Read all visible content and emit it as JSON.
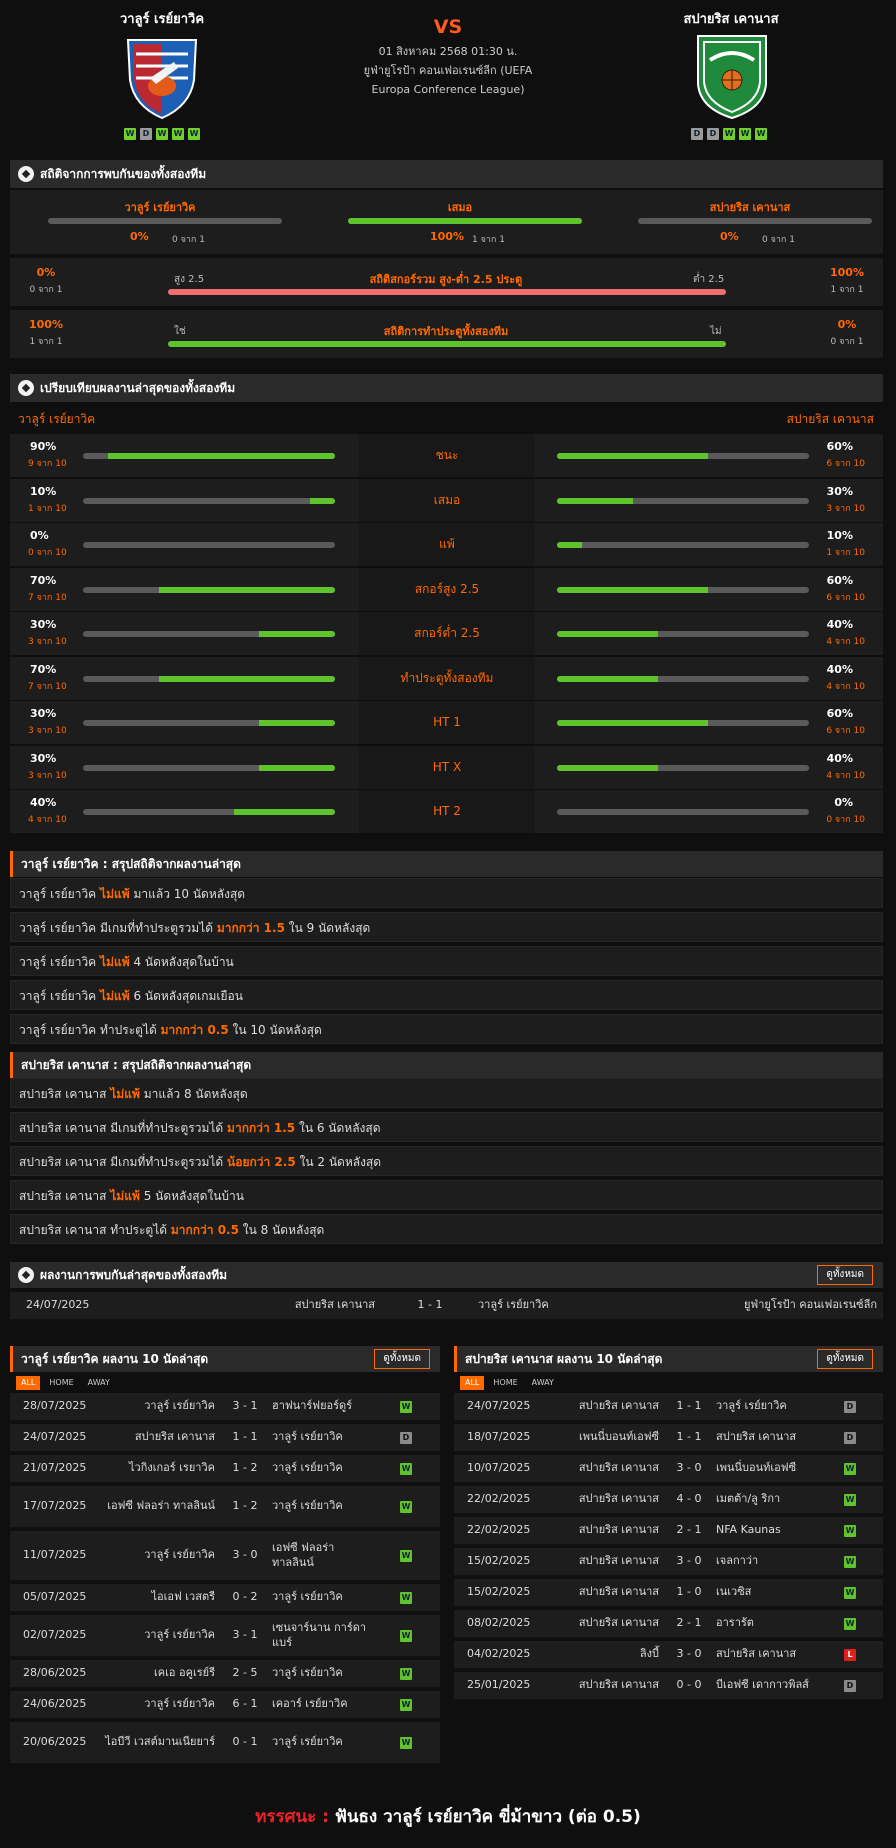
{
  "home": {
    "name": "วาลูร์ เรย์ยาวิค",
    "form": [
      "W",
      "D",
      "W",
      "W",
      "W"
    ]
  },
  "away": {
    "name": "สปายริส เคานาส",
    "form": [
      "D",
      "D",
      "W",
      "W",
      "W"
    ]
  },
  "vs": "VS",
  "match": {
    "date": "01 สิงหาคม 2568 01:30 น.",
    "league": "ยูฟ่ายูโรป้า คอนเฟอเรนซ์ลีก (UEFA Europa Conference League)"
  },
  "h2h_stats": {
    "title": "สถิติจากการพบกันของทั้งสองทีม",
    "results": [
      {
        "label": "วาลูร์ เรย์ยาวิค",
        "pct": "0%",
        "sub": "0 จาก 1",
        "fill": 0
      },
      {
        "label": "เสมอ",
        "pct": "100%",
        "sub": "1 จาก 1",
        "fill": 100
      },
      {
        "label": "สปายริส เคานาส",
        "pct": "0%",
        "sub": "0 จาก 1",
        "fill": 0
      }
    ],
    "ou": {
      "title": "สถิติสกอร์รวม สูง-ต่ำ 2.5 ประตู",
      "left_label": "สูง 2.5",
      "right_label": "ต่ำ 2.5",
      "left_pct": "0%",
      "left_sub": "0 จาก 1",
      "right_pct": "100%",
      "right_sub": "1 จาก 1",
      "fill": 0
    },
    "btts": {
      "title": "สถิติการทำประตูทั้งสองทีม",
      "left_label": "ใช่",
      "right_label": "ไม่",
      "left_pct": "100%",
      "left_sub": "1 จาก 1",
      "right_pct": "0%",
      "right_sub": "0 จาก 1",
      "fill": 100
    }
  },
  "compare": {
    "title": "เปรียบเทียบผลงานล่าสุดของทั้งสองทีม",
    "home_label": "วาลูร์ เรย์ยาวิค",
    "away_label": "สปายริส เคานาส",
    "rows": [
      {
        "label": "ชนะ",
        "hp": "90%",
        "hs": "9 จาก 10",
        "hv": 90,
        "ap": "60%",
        "as": "6 จาก 10",
        "av": 60
      },
      {
        "label": "เสมอ",
        "hp": "10%",
        "hs": "1 จาก 10",
        "hv": 10,
        "ap": "30%",
        "as": "3 จาก 10",
        "av": 30
      },
      {
        "label": "แพ้",
        "hp": "0%",
        "hs": "0 จาก 10",
        "hv": 0,
        "ap": "10%",
        "as": "1 จาก 10",
        "av": 10
      },
      {
        "label": "สกอร์สูง 2.5",
        "hp": "70%",
        "hs": "7 จาก 10",
        "hv": 70,
        "ap": "60%",
        "as": "6 จาก 10",
        "av": 60
      },
      {
        "label": "สกอร์ต่ำ 2.5",
        "hp": "30%",
        "hs": "3 จาก 10",
        "hv": 30,
        "ap": "40%",
        "as": "4 จาก 10",
        "av": 40
      },
      {
        "label": "ทำประตูทั้งสองทีม",
        "hp": "70%",
        "hs": "7 จาก 10",
        "hv": 70,
        "ap": "40%",
        "as": "4 จาก 10",
        "av": 40
      },
      {
        "label": "HT 1",
        "hp": "30%",
        "hs": "3 จาก 10",
        "hv": 30,
        "ap": "60%",
        "as": "6 จาก 10",
        "av": 60
      },
      {
        "label": "HT X",
        "hp": "30%",
        "hs": "3 จาก 10",
        "hv": 30,
        "ap": "40%",
        "as": "4 จาก 10",
        "av": 40
      },
      {
        "label": "HT 2",
        "hp": "40%",
        "hs": "4 จาก 10",
        "hv": 40,
        "ap": "0%",
        "as": "0 จาก 10",
        "av": 0
      }
    ]
  },
  "home_summary": {
    "title": "วาลูร์ เรย์ยาวิค : สรุปสถิติจากผลงานล่าสุด",
    "rows": [
      [
        "วาลูร์ เรย์ยาวิค",
        "ไม่แพ้",
        "มาแล้ว 10 นัดหลังสุด"
      ],
      [
        "วาลูร์ เรย์ยาวิค  มีเกมที่ทำประตูรวมได้",
        "มากกว่า  1.5",
        "ใน 9 นัดหลังสุด"
      ],
      [
        "วาลูร์ เรย์ยาวิค",
        "ไม่แพ้",
        "4  นัดหลังสุดในบ้าน"
      ],
      [
        "วาลูร์ เรย์ยาวิค",
        "ไม่แพ้",
        "6  นัดหลังสุดเกมเยือน"
      ],
      [
        "วาลูร์ เรย์ยาวิค  ทำประตูได้",
        "มากกว่า  0.5",
        "ใน 10 นัดหลังสุด"
      ]
    ]
  },
  "away_summary": {
    "title": "สปายริส เคานาส : สรุปสถิติจากผลงานล่าสุด",
    "rows": [
      [
        "สปายริส เคานาส",
        "ไม่แพ้",
        "มาแล้ว 8 นัดหลังสุด"
      ],
      [
        "สปายริส เคานาส  มีเกมที่ทำประตูรวมได้",
        "มากกว่า  1.5",
        "ใน 6 นัดหลังสุด"
      ],
      [
        "สปายริส เคานาส  มีเกมที่ทำประตูรวมได้",
        "น้อยกว่า  2.5",
        "ใน 2 นัดหลังสุด"
      ],
      [
        "สปายริส เคานาส",
        "ไม่แพ้",
        "5  นัดหลังสุดในบ้าน"
      ],
      [
        "สปายริส เคานาส  ทำประตูได้",
        "มากกว่า  0.5",
        "ใน 8 นัดหลังสุด"
      ]
    ]
  },
  "h2h_results": {
    "title": "ผลงานการพบกันล่าสุดของทั้งสองทีม",
    "all_label": "ดูทั้งหมด",
    "rows": [
      {
        "date": "24/07/2025",
        "home": "สปายริส เคานาส",
        "score": "1 - 1",
        "away": "วาลูร์ เรย์ยาวิค",
        "league": "ยูฟ่ายูโรป้า คอนเฟอเรนซ์ลีก"
      }
    ]
  },
  "tabs": [
    "ALL",
    "HOME",
    "AWAY"
  ],
  "home_last": {
    "title": "วาลูร์ เรย์ยาวิค ผลงาน 10 นัดล่าสุด",
    "all_label": "ดูทั้งหมด",
    "rows": [
      {
        "date": "28/07/2025",
        "home": "วาลูร์ เรย์ยาวิค",
        "score": "3 - 1",
        "away": "ฮาฟนาร์ฟยอร์ดูร์",
        "r": "W"
      },
      {
        "date": "24/07/2025",
        "home": "สปายริส เคานาส",
        "score": "1 - 1",
        "away": "วาลูร์ เรย์ยาวิค",
        "r": "D"
      },
      {
        "date": "21/07/2025",
        "home": "ไวกิงเกอร์ เรยาวิค",
        "score": "1 - 2",
        "away": "วาลูร์ เรย์ยาวิค",
        "r": "W"
      },
      {
        "date": "17/07/2025",
        "home": "เอฟซี ฟลอร่า ทาลลินน์",
        "score": "1 - 2",
        "away": "วาลูร์ เรย์ยาวิค",
        "r": "W"
      },
      {
        "date": "11/07/2025",
        "home": "วาลูร์ เรย์ยาวิค",
        "score": "3 - 0",
        "away": "เอฟซี ฟลอร่า ทาลลินน์",
        "r": "W"
      },
      {
        "date": "05/07/2025",
        "home": "ไอเอฟ เวสตรี",
        "score": "0 - 2",
        "away": "วาลูร์ เรย์ยาวิค",
        "r": "W"
      },
      {
        "date": "02/07/2025",
        "home": "วาลูร์ เรย์ยาวิค",
        "score": "3 - 1",
        "away": "เซนจาร์นาน การ์ดาแบร์",
        "r": "W"
      },
      {
        "date": "28/06/2025",
        "home": "เคเอ อคูเรย์รี",
        "score": "2 - 5",
        "away": "วาลูร์ เรย์ยาวิค",
        "r": "W"
      },
      {
        "date": "24/06/2025",
        "home": "วาลูร์ เรย์ยาวิค",
        "score": "6 - 1",
        "away": "เคอาร์ เรย์ยาวิค",
        "r": "W"
      },
      {
        "date": "20/06/2025",
        "home": "ไอบีวี เวสต์มานเนียยาร์",
        "score": "0 - 1",
        "away": "วาลูร์ เรย์ยาวิค",
        "r": "W"
      }
    ]
  },
  "away_last": {
    "title": "สปายริส เคานาส ผลงาน 10 นัดล่าสุด",
    "all_label": "ดูทั้งหมด",
    "rows": [
      {
        "date": "24/07/2025",
        "home": "สปายริส เคานาส",
        "score": "1 - 1",
        "away": "วาลูร์ เรย์ยาวิค",
        "r": "D"
      },
      {
        "date": "18/07/2025",
        "home": "เพนนี่บอนท์เอฟซี",
        "score": "1 - 1",
        "away": "สปายริส เคานาส",
        "r": "D"
      },
      {
        "date": "10/07/2025",
        "home": "สปายริส เคานาส",
        "score": "3 - 0",
        "away": "เพนนี่บอนท์เอฟซี",
        "r": "W"
      },
      {
        "date": "22/02/2025",
        "home": "สปายริส เคานาส",
        "score": "4 - 0",
        "away": "เมตต้า/ลู ริกา",
        "r": "W"
      },
      {
        "date": "22/02/2025",
        "home": "สปายริส เคานาส",
        "score": "2 - 1",
        "away": "NFA Kaunas",
        "r": "W"
      },
      {
        "date": "15/02/2025",
        "home": "สปายริส เคานาส",
        "score": "3 - 0",
        "away": "เจลกาว่า",
        "r": "W"
      },
      {
        "date": "15/02/2025",
        "home": "สปายริส เคานาส",
        "score": "1 - 0",
        "away": "เนเวซิส",
        "r": "W"
      },
      {
        "date": "08/02/2025",
        "home": "สปายริส เคานาส",
        "score": "2 - 1",
        "away": "อารารัต",
        "r": "W"
      },
      {
        "date": "04/02/2025",
        "home": "ลิงบี้",
        "score": "3 - 0",
        "away": "สปายริส เคานาส",
        "r": "L"
      },
      {
        "date": "25/01/2025",
        "home": "สปายริส เคานาส",
        "score": "0 - 0",
        "away": "บีเอฟซี เดากาวพิลส์",
        "r": "D"
      }
    ]
  },
  "prediction": {
    "label": "ทรรศนะ :",
    "text": "ฟันธง วาลูร์ เรย์ยาวิค ขี่ม้าขาว (ต่อ 0.5)"
  },
  "colors": {
    "accent": "#ff6a00",
    "win": "#5fc42b",
    "draw": "#8a8a8a",
    "loss": "#e0201f",
    "bar_red": "#f07070"
  }
}
